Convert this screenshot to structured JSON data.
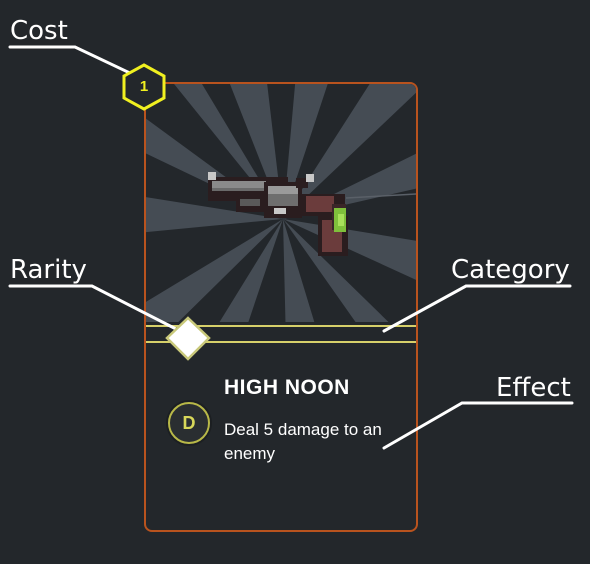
{
  "labels": {
    "cost": "Cost",
    "rarity": "Rarity",
    "category": "Category",
    "effect": "Effect"
  },
  "card": {
    "cost": "1",
    "name": "HIGH NOON",
    "category_letter": "D",
    "description": "Deal 5 damage to an enemy",
    "art": "revolver-pixel-art",
    "colors": {
      "border": "#b9531e",
      "background": "#23272b",
      "cost_hex": "#f0f020",
      "rarity_lines": "#d6d06a",
      "category_badge": "#d8d85a"
    }
  }
}
